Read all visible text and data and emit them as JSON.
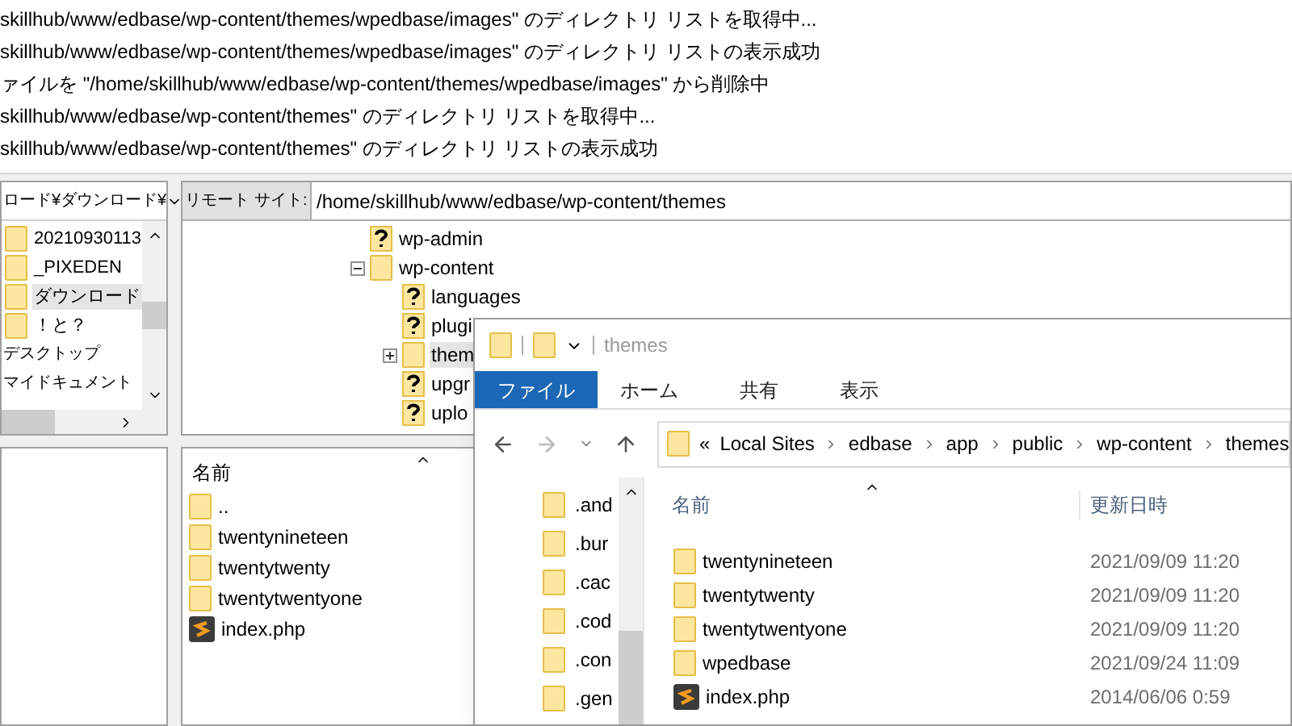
{
  "log": [
    "skillhub/www/edbase/wp-content/themes/wpedbase/images\" のディレクトリ リストを取得中...",
    "skillhub/www/edbase/wp-content/themes/wpedbase/images\" のディレクトリ リストの表示成功",
    "ァイルを \"/home/skillhub/www/edbase/wp-content/themes/wpedbase/images\" から削除中",
    "skillhub/www/edbase/wp-content/themes\" のディレクトリ リストを取得中...",
    "skillhub/www/edbase/wp-content/themes\" のディレクトリ リストの表示成功"
  ],
  "local_site": {
    "path": "ロード¥ダウンロード¥",
    "tree": [
      {
        "label": "20210930113",
        "kind": "folder",
        "selected": false
      },
      {
        "label": "_PIXEDEN",
        "kind": "folder",
        "selected": false
      },
      {
        "label": "ダウンロード",
        "kind": "folder",
        "selected": true
      },
      {
        "label": "！と？",
        "kind": "folder",
        "selected": false
      },
      {
        "label": "デスクトップ",
        "kind": "plain",
        "selected": false
      },
      {
        "label": "マイドキュメント",
        "kind": "plain",
        "selected": false
      }
    ]
  },
  "remote_site": {
    "label": "リモート サイト:",
    "path": "/home/skillhub/www/edbase/wp-content/themes",
    "tree": [
      {
        "label": "wp-admin",
        "kind": "unknown",
        "selected": false
      },
      {
        "label": "wp-content",
        "kind": "folder",
        "selected": false,
        "expanded": true,
        "children": [
          {
            "label": "languages",
            "kind": "unknown",
            "selected": false
          },
          {
            "label": "plugi",
            "kind": "unknown",
            "selected": false
          },
          {
            "label": "them",
            "kind": "folder",
            "selected": true,
            "expanded": false
          },
          {
            "label": "upgr",
            "kind": "unknown",
            "selected": false
          },
          {
            "label": "uplo",
            "kind": "unknown",
            "selected": false
          }
        ]
      }
    ],
    "files": {
      "column_name": "名前",
      "rows": [
        {
          "name": "..",
          "kind": "folder"
        },
        {
          "name": "twentynineteen",
          "kind": "folder"
        },
        {
          "name": "twentytwenty",
          "kind": "folder"
        },
        {
          "name": "twentytwentyone",
          "kind": "folder"
        },
        {
          "name": "index.php",
          "kind": "script"
        }
      ]
    }
  },
  "explorer": {
    "title": "themes",
    "tabs": [
      {
        "label": "ファイル",
        "selected": true
      },
      {
        "label": "ホーム",
        "selected": false
      },
      {
        "label": "共有",
        "selected": false
      },
      {
        "label": "表示",
        "selected": false
      }
    ],
    "breadcrumb_overflow": "«",
    "breadcrumb": [
      "Local Sites",
      "edbase",
      "app",
      "public",
      "wp-content",
      "themes"
    ],
    "nav_pane": [
      ".and",
      ".bur",
      ".cac",
      ".cod",
      ".con",
      ".gen"
    ],
    "columns": [
      "名前",
      "更新日時"
    ],
    "rows": [
      {
        "name": "twentynineteen",
        "date": "2021/09/09 11:20",
        "kind": "folder"
      },
      {
        "name": "twentytwenty",
        "date": "2021/09/09 11:20",
        "kind": "folder"
      },
      {
        "name": "twentytwentyone",
        "date": "2021/09/09 11:20",
        "kind": "folder"
      },
      {
        "name": "wpedbase",
        "date": "2021/09/24 11:09",
        "kind": "folder"
      },
      {
        "name": "index.php",
        "date": "2014/06/06 0:59",
        "kind": "script"
      }
    ]
  }
}
